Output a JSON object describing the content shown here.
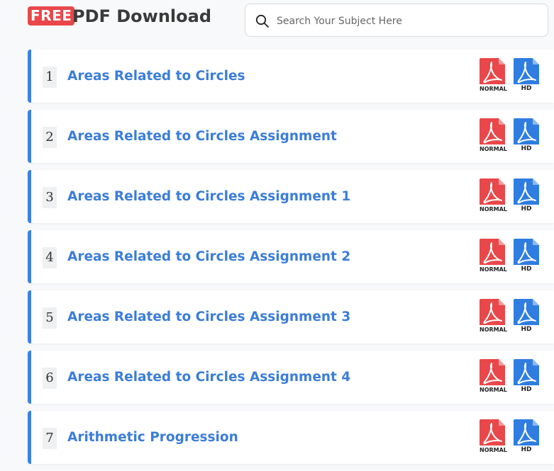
{
  "header": {
    "badge": "FREE",
    "title": "PDF Download",
    "search_placeholder": "Search Your Subject Here"
  },
  "colors": {
    "accent": "#3b82e0",
    "badge": "#e9474a",
    "pdf_normal": "#e9474a",
    "pdf_hd": "#2f7de1"
  },
  "icons": {
    "search": "search-icon",
    "pdf_normal": "pdf-normal-icon",
    "pdf_hd": "pdf-hd-icon"
  },
  "downloads": {
    "normal_label": "NORMAL",
    "hd_label": "HD"
  },
  "items": [
    {
      "num": "1",
      "title": "Areas Related to Circles"
    },
    {
      "num": "2",
      "title": "Areas Related to Circles Assignment"
    },
    {
      "num": "3",
      "title": "Areas Related to Circles Assignment 1"
    },
    {
      "num": "4",
      "title": "Areas Related to Circles Assignment 2"
    },
    {
      "num": "5",
      "title": "Areas Related to Circles Assignment 3"
    },
    {
      "num": "6",
      "title": "Areas Related to Circles Assignment 4"
    },
    {
      "num": "7",
      "title": "Arithmetic Progression"
    }
  ]
}
